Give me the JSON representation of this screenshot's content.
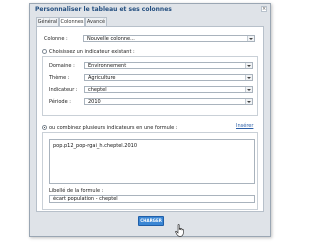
{
  "dialog": {
    "title": "Personnaliser le tableau et ses colonnes",
    "close_icon": "close-icon",
    "tabs": [
      {
        "label": "Général",
        "active": false
      },
      {
        "label": "Colonnes",
        "active": true
      },
      {
        "label": "Avancé",
        "active": false
      }
    ]
  },
  "form": {
    "colonne_label": "Colonne :",
    "colonne_value": "Nouvelle colonne...",
    "radio_existing_label": "Choisissez un indicateur existant :",
    "domaine_label": "Domaine :",
    "domaine_value": "Environnement",
    "theme_label": "Thème :",
    "theme_value": "Agriculture",
    "indicateur_label": "Indicateur :",
    "indicateur_value": "cheptel",
    "periode_label": "Période :",
    "periode_value": "2010",
    "radio_formula_label": "ou combinez plusieurs indicateurs en une formule :",
    "inserer_link": "Insérer",
    "formula_text": "pop.p12_pop-rgai_h.cheptel.2010",
    "libelle_label": "Libellé de la formule :",
    "libelle_value": "écart population - cheptel",
    "submit_label": "CHARGER"
  },
  "state": {
    "radio_existing_checked": false,
    "radio_formula_checked": true
  },
  "colors": {
    "accent": "#3a86d4",
    "title": "#234e7f",
    "link": "#2b5fa8"
  },
  "icons": {
    "cursor": "hand-pointer-icon",
    "dropdown": "chevron-down-icon"
  }
}
